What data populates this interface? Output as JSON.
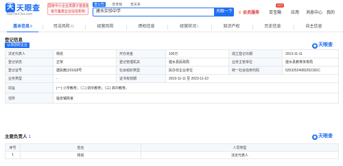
{
  "header": {
    "logo_mark": "天",
    "logo_name": "天眼查",
    "logo_url": "TianYanCha.com",
    "promo_lines": [
      "国家中小企业发展子基金旗下",
      "官方备案企业征信机构"
    ],
    "search_types": [
      "查公司",
      "查老板",
      "查关系"
    ],
    "search_value": "建水实验中学",
    "search_button": "天眼一下",
    "vip_label": "会员服务",
    "enterprise_label": "百宝箱",
    "apps_label": "应用",
    "messages_label": "消息中心",
    "hot_badge": "HOT",
    "user_label": "我的"
  },
  "tabs": [
    {
      "label": "基本信息",
      "count": "8"
    },
    {
      "label": "司法风险",
      "count": "31"
    },
    {
      "label": "经营风险",
      "count": ""
    },
    {
      "label": "债权信息",
      "count": ""
    },
    {
      "label": "经营状况",
      "count": "1"
    },
    {
      "label": "知识产权",
      "count": ""
    },
    {
      "label": "历史信息",
      "count": ""
    },
    {
      "label": "自主信息",
      "count": ""
    }
  ],
  "registration": {
    "title": "登记信息",
    "claim_link": "认领您的企业",
    "brand": "天眼查",
    "rows": [
      {
        "l1": "法定代表人",
        "v1": "杨昆",
        "l2": "开办资金",
        "v2": "100万",
        "l3": "成立登记日期",
        "v3": "2013-11-11"
      },
      {
        "l1": "登记状态",
        "v1": "正常",
        "l2": "登记管理机关",
        "v2": "建水县民政局",
        "l3": "业务主管单位",
        "v3": "建水县教育体育局"
      },
      {
        "l1": "登记证号",
        "v1": "建民教(2016)8号",
        "l2": "社会组织类型",
        "v2": "民办非企业单位",
        "l3": "统一社会信用代码",
        "v3": "52532524083252181C"
      },
      {
        "l1": "业务类型",
        "v1": "-",
        "l2": "证书有效期",
        "v2": "2019-11-11 至 2023-11-10",
        "l3": "",
        "v3": ""
      }
    ],
    "scope_label": "宗旨",
    "scope_value": "(一) 小学教育；（二) 初中教育；（三) 高中教育。",
    "address_label": "住所",
    "address_value": "临安镇陈官"
  },
  "personnel": {
    "title": "主要负责人",
    "count": "1",
    "brand": "天眼查",
    "headers": [
      "序号",
      "姓名",
      "人员类型"
    ],
    "rows": [
      {
        "no": "1",
        "name": "杨昆",
        "type": "法定代表人"
      }
    ]
  }
}
